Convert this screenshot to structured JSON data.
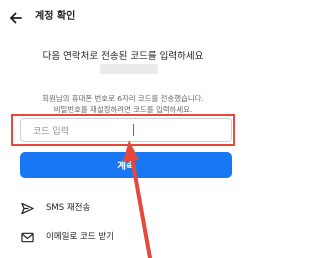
{
  "header": {
    "title": "계정 확인",
    "back_icon": "back-arrow-icon"
  },
  "prompt": "다음 연락처로 전송된 코드를 입력하세요",
  "description": {
    "line1": "회원님의 휴대폰 번호로 6자리 코드를 전송했습니다.",
    "line2": "비밀번호를 재설정하려면 코드를 입력하세요."
  },
  "code_input": {
    "placeholder": "코드 입력",
    "value": ""
  },
  "confirm_button": "계속",
  "options": {
    "sms": {
      "label": "SMS 재전송",
      "icon": "send-icon"
    },
    "email": {
      "label": "이메일로 코드 받기",
      "icon": "mail-icon"
    }
  },
  "colors": {
    "primary": "#1877f2",
    "highlight": "#e8473c"
  }
}
